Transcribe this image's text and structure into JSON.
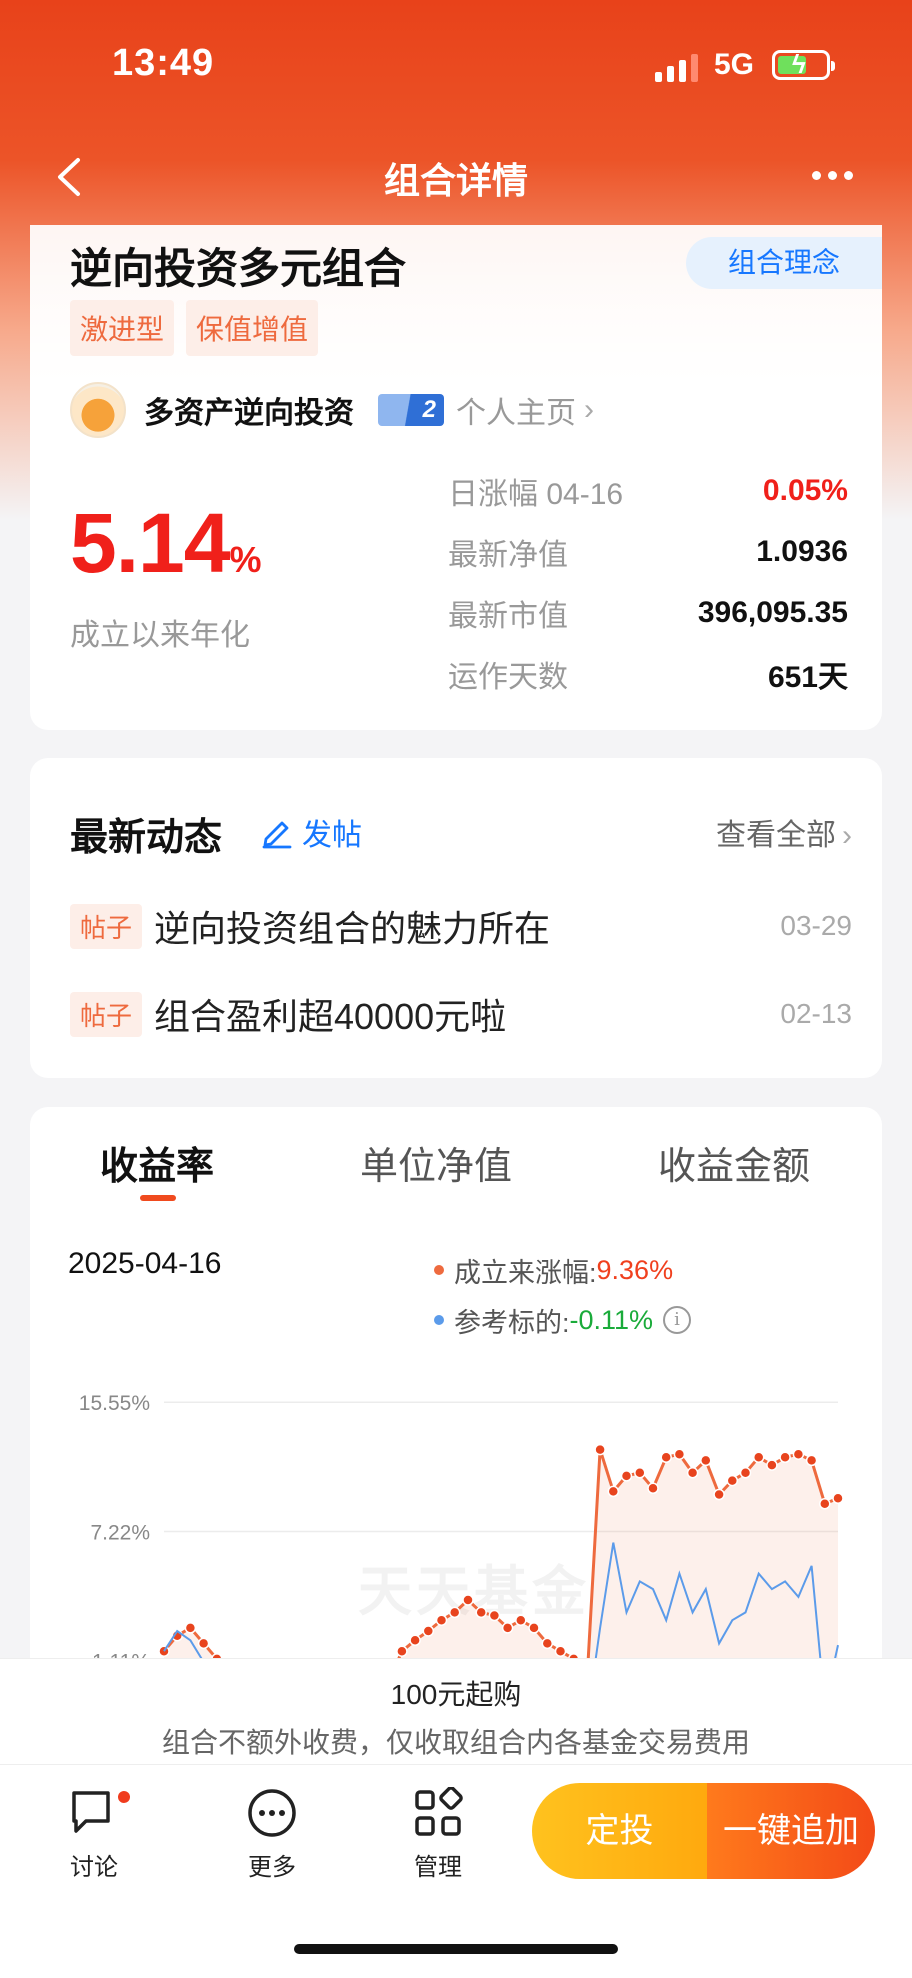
{
  "status_bar": {
    "time": "13:49",
    "network": "5G"
  },
  "nav": {
    "title": "组合详情"
  },
  "portfolio": {
    "name": "逆向投资多元组合",
    "concept_button": "组合理念",
    "tags": [
      "激进型",
      "保值增值"
    ],
    "manager_name": "多资产逆向投资",
    "manager_level": "2",
    "homepage_link": "个人主页",
    "annualized_rate": "5.14",
    "annualized_unit": "%",
    "annualized_label": "成立以来年化",
    "stats": [
      {
        "label": "日涨幅 04-16",
        "value": "0.05%"
      },
      {
        "label": "最新净值",
        "value": "1.0936"
      },
      {
        "label": "最新市值",
        "value": "396,095.35"
      },
      {
        "label": "运作天数",
        "value": "651天"
      }
    ],
    "colors": {
      "positive": "#f0201a"
    }
  },
  "news": {
    "title": "最新动态",
    "post_button": "发帖",
    "view_all": "查看全部",
    "items": [
      {
        "tag": "帖子",
        "title": "逆向投资组合的魅力所在",
        "date": "03-29"
      },
      {
        "tag": "帖子",
        "title": "组合盈利超40000元啦",
        "date": "02-13"
      }
    ]
  },
  "chart_section": {
    "tabs": [
      "收益率",
      "单位净值",
      "收益金额"
    ],
    "active_tab": 0,
    "date": "2025-04-16",
    "legend": [
      {
        "label": "成立来涨幅:",
        "value": "9.36%",
        "color": "#ee6a3e"
      },
      {
        "label": "参考标的:",
        "value": "-0.11%",
        "color": "#5b9bea"
      }
    ],
    "watermark": "天天基金"
  },
  "chart_data": {
    "type": "line",
    "y_ticks": [
      "15.55%",
      "7.22%",
      "-1.11%"
    ],
    "y_tick_values": [
      15.55,
      7.22,
      -1.11
    ],
    "ylim": [
      -7.0,
      17.5
    ],
    "series": [
      {
        "name": "成立来涨幅",
        "color": "#ee6a3e",
        "values": [
          -0.5,
          0.5,
          1.0,
          0.0,
          -1.0,
          -1.5,
          -2.0,
          -2.8,
          -3.0,
          -3.2,
          -3.5,
          -3.4,
          -4.2,
          -4.8,
          -5.1,
          -5.6,
          -4.2,
          -2.5,
          -0.5,
          0.2,
          0.8,
          1.5,
          2.0,
          2.8,
          2.0,
          1.8,
          1.0,
          1.5,
          1.0,
          0.0,
          -0.5,
          -1.0,
          -2.5,
          12.5,
          9.8,
          10.8,
          11.0,
          10.0,
          12.0,
          12.2,
          11.0,
          11.8,
          9.6,
          10.5,
          11.0,
          12.0,
          11.5,
          12.0,
          12.2,
          11.8,
          9.0,
          9.36
        ]
      },
      {
        "name": "参考标的",
        "color": "#5b9bea",
        "values": [
          -0.5,
          0.8,
          0.2,
          -1.2,
          -2.5,
          -3.0,
          -4.0,
          -4.5,
          -4.8,
          -5.2,
          -6.0,
          -6.2,
          -5.8,
          -6.5,
          -7.0,
          -7.0,
          -6.0,
          -5.5,
          -6.2,
          -4.5,
          -6.0,
          -4.2,
          -3.8,
          -5.2,
          -6.2,
          -6.8,
          -7.0,
          -6.5,
          -7.0,
          -7.0,
          -6.8,
          -6.5,
          -5.0,
          1.0,
          6.5,
          2.0,
          4.0,
          3.5,
          1.5,
          4.5,
          2.0,
          3.5,
          0.0,
          1.5,
          2.0,
          4.5,
          3.5,
          4.0,
          3.0,
          5.0,
          -4.0,
          -0.11
        ]
      }
    ]
  },
  "purchase": {
    "headline": "100元起购",
    "note": "组合不额外收费，仅收取组合内各基金交易费用"
  },
  "bottom_nav": {
    "items": [
      {
        "label": "讨论",
        "icon": "chat-icon"
      },
      {
        "label": "更多",
        "icon": "more-circle-icon"
      },
      {
        "label": "管理",
        "icon": "grid-icon"
      }
    ],
    "invest_button": "定投",
    "add_button": "一键追加"
  }
}
